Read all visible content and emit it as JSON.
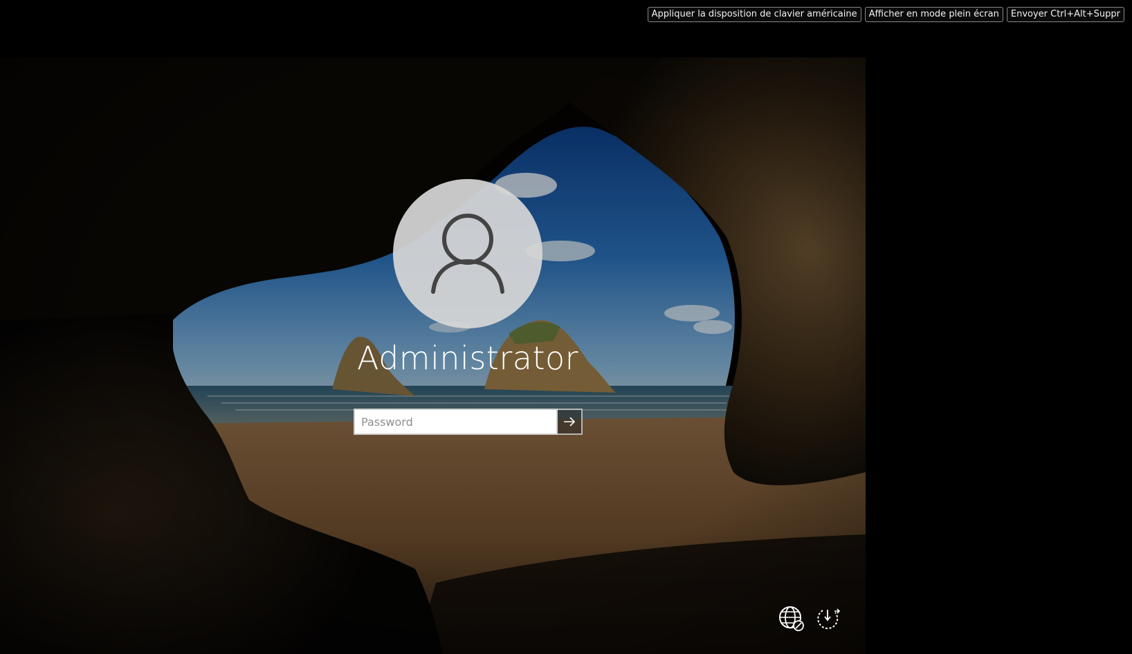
{
  "toolbar": {
    "us_keyboard_label": "Appliquer la disposition de clavier américaine",
    "fullscreen_label": "Afficher en mode plein écran",
    "ctrl_alt_del_label": "Envoyer Ctrl+Alt+Suppr"
  },
  "login": {
    "username": "Administrator",
    "password_placeholder": "Password",
    "password_value": ""
  },
  "icons": {
    "avatar": "user-silhouette-icon",
    "submit": "arrow-right-icon",
    "accessibility": "ease-of-access-network-icon",
    "power": "power-icon",
    "cursor": "mouse-pointer-icon"
  },
  "colors": {
    "page_background": "#000000",
    "avatar_circle": "#d6d6d6",
    "text": "#ffffff",
    "button_border": "#8a8a8a"
  }
}
